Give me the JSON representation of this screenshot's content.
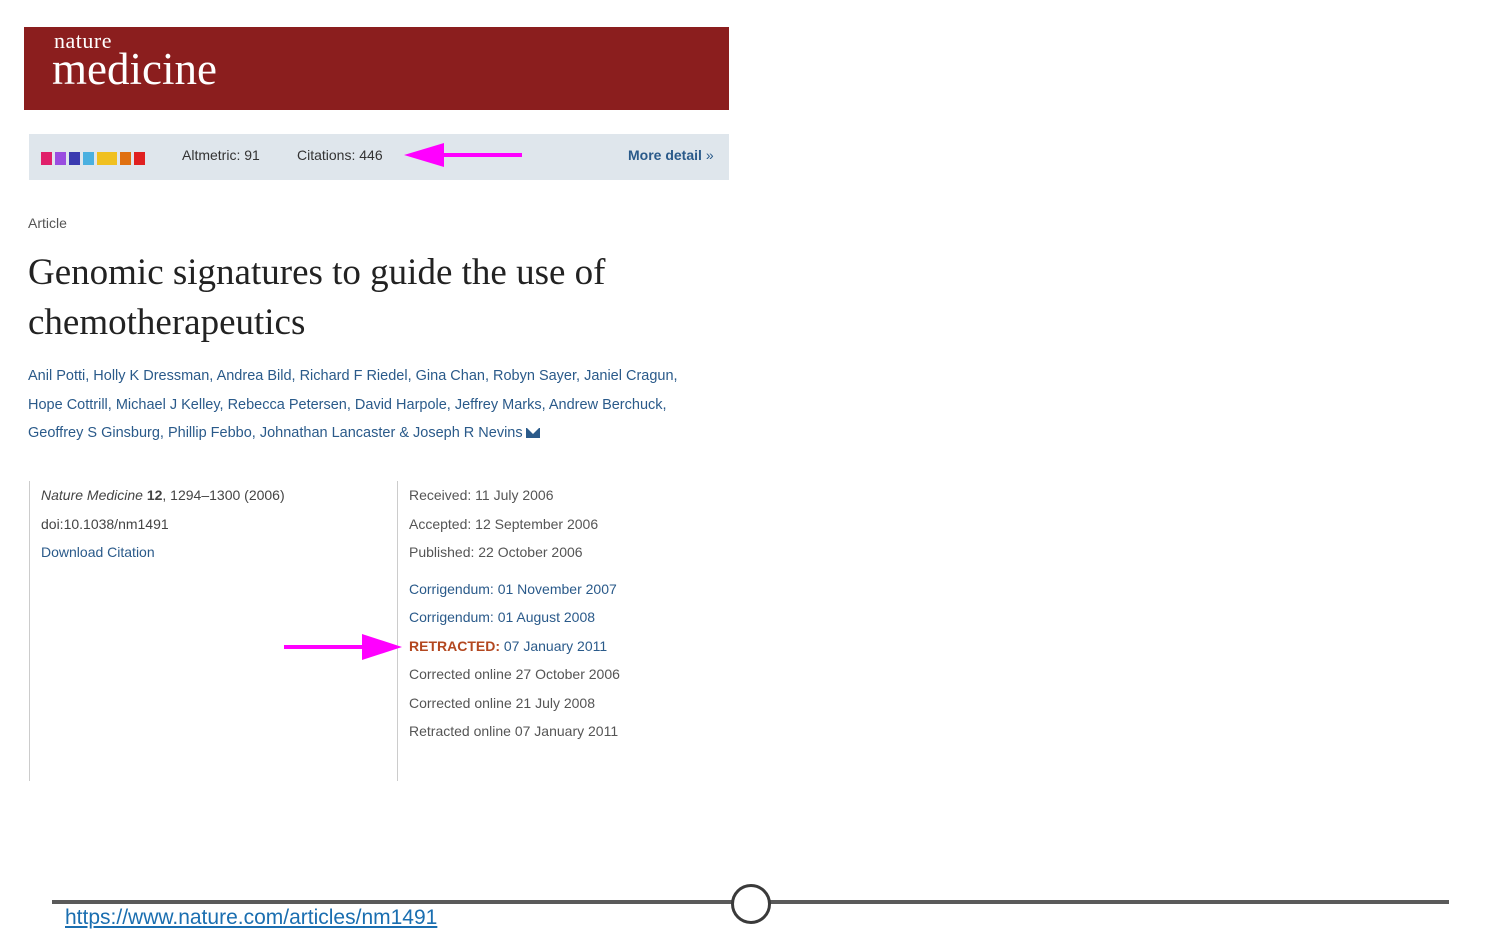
{
  "header": {
    "logo_small": "nature",
    "logo_big": "medicine",
    "bg_color": "#8b1e1e"
  },
  "metrics": {
    "swatch_colors": [
      "#e0206a",
      "#9a4de0",
      "#3a3ab0",
      "#4ab0e0",
      "#f0c020",
      "#e07010",
      "#e02020"
    ],
    "altmetric": "Altmetric: 91",
    "citations": "Citations: 446",
    "more_detail": "More detail",
    "more_detail_chevron": "»"
  },
  "article": {
    "type": "Article",
    "title": "Genomic signatures to guide the use of chemotherapeutics",
    "authors": [
      "Anil Potti, Holly K Dressman, Andrea Bild, Richard F Riedel, Gina Chan, Robyn Sayer, Janiel Cragun,",
      "Hope Cottrill, Michael J Kelley, Rebecca Petersen, David Harpole, Jeffrey Marks, Andrew Berchuck,",
      "Geoffrey S Ginsburg, Phillip Febbo, Johnathan Lancaster & Joseph R Nevins"
    ]
  },
  "citation": {
    "journal": "Nature Medicine",
    "volume": "12",
    "pages_year": ", 1294–1300 (2006)",
    "doi": "doi:10.1038/nm1491",
    "download": "Download Citation"
  },
  "dates": {
    "received": "Received:  11 July 2006",
    "accepted": "Accepted:  12 September 2006",
    "published": "Published:  22 October 2006",
    "corrigendum1": "Corrigendum: 01 November 2007",
    "corrigendum2": "Corrigendum: 01 August 2008",
    "retracted_label": "RETRACTED:",
    "retracted_date": " 07 January 2011",
    "corrected1": "Corrected online 27 October 2006",
    "corrected2": "Corrected online 21 July 2008",
    "retracted_online": "Retracted online 07 January 2011"
  },
  "annotation_color": "#ff00ff",
  "footer": {
    "url": "https://www.nature.com/articles/nm1491"
  }
}
